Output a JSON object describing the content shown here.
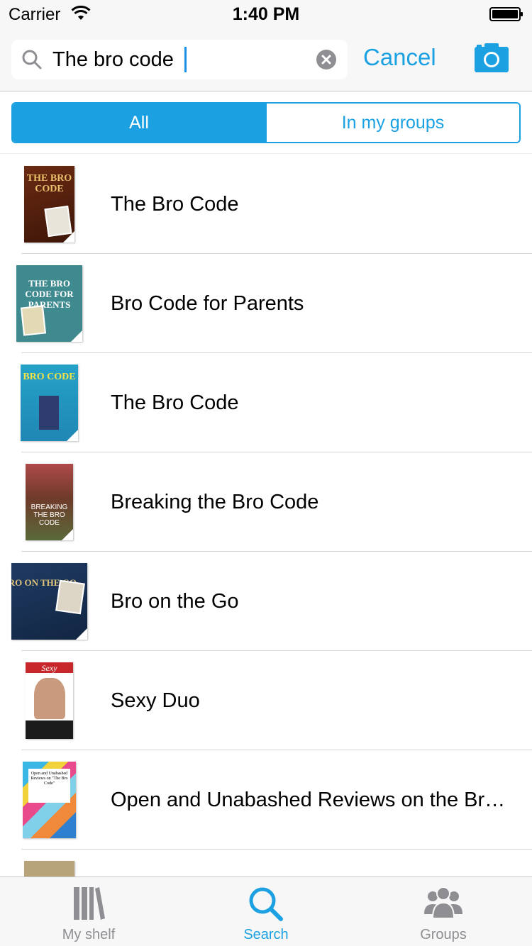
{
  "status_bar": {
    "carrier": "Carrier",
    "time": "1:40 PM"
  },
  "search": {
    "query": "The bro code",
    "cancel_label": "Cancel"
  },
  "segments": {
    "all": "All",
    "groups": "In my groups",
    "selected": "All"
  },
  "results": [
    {
      "title": "The Bro Code",
      "cover_text": "THE BRO CODE"
    },
    {
      "title": "Bro Code for Parents",
      "cover_text": "THE BRO CODE FOR PARENTS"
    },
    {
      "title": "The Bro Code",
      "cover_text": "BRO CODE"
    },
    {
      "title": "Breaking the Bro Code",
      "cover_text": "BREAKING THE BRO CODE"
    },
    {
      "title": "Bro on the Go",
      "cover_text": "BRO ON THE GO"
    },
    {
      "title": "Sexy Duo",
      "cover_text": "Sexy"
    },
    {
      "title": "Open and Unabashed Reviews on the Br…",
      "cover_text": "Open and Unabashed Reviews on \"The Bro Code\""
    },
    {
      "title": "",
      "cover_text": ""
    }
  ],
  "tabs": [
    {
      "label": "My shelf",
      "icon": "books-icon"
    },
    {
      "label": "Search",
      "icon": "search-icon"
    },
    {
      "label": "Groups",
      "icon": "people-icon"
    }
  ],
  "colors": {
    "accent": "#1ba1e2",
    "inactive": "#8e8e93"
  }
}
